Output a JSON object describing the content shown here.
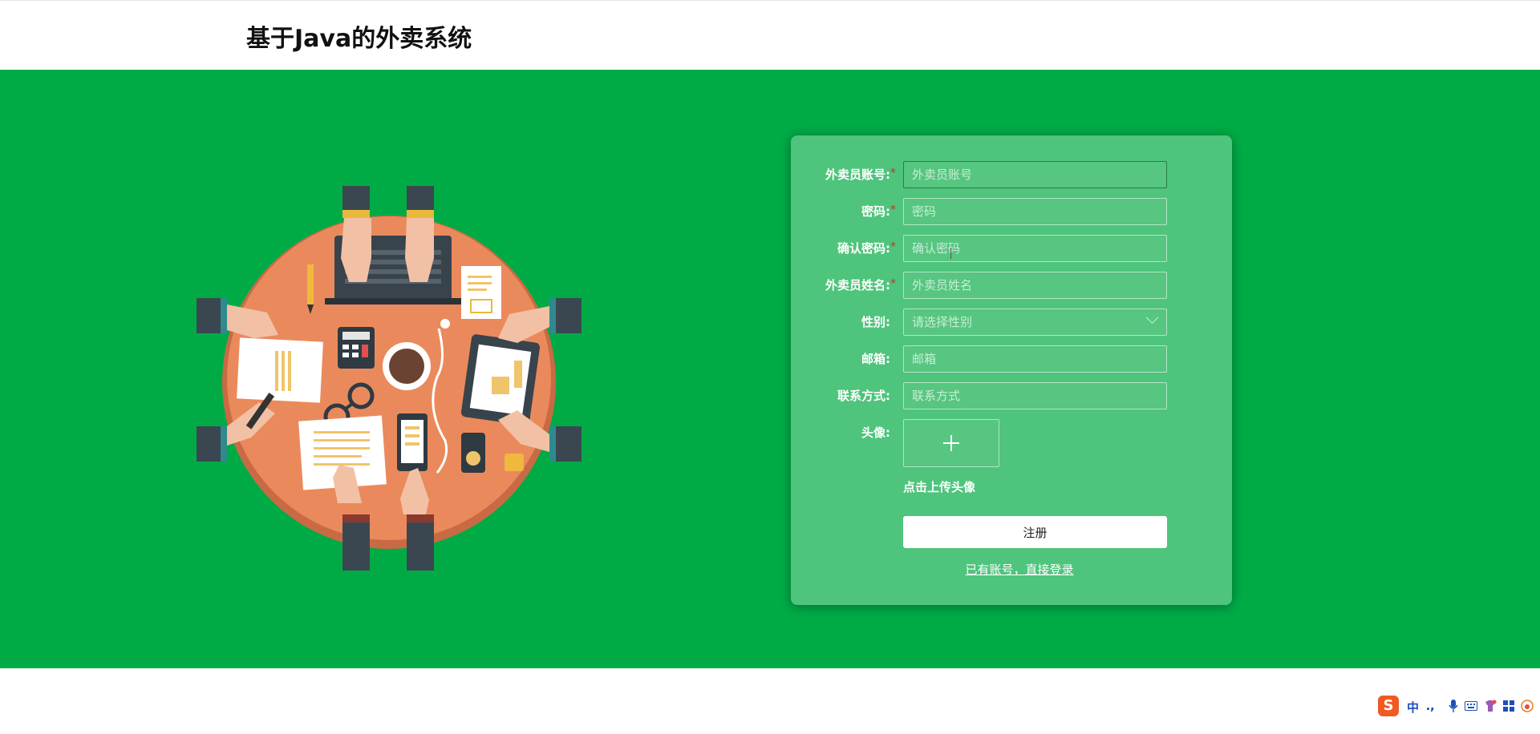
{
  "header": {
    "title": "基于Java的外卖系统"
  },
  "form": {
    "fields": [
      {
        "label": "外卖员账号:",
        "required": true,
        "placeholder": "外卖员账号"
      },
      {
        "label": "密码:",
        "required": true,
        "placeholder": "密码"
      },
      {
        "label": "确认密码:",
        "required": true,
        "placeholder": "确认密码"
      },
      {
        "label": "外卖员姓名:",
        "required": true,
        "placeholder": "外卖员姓名"
      },
      {
        "label": "性别:",
        "required": false,
        "placeholder": "请选择性别"
      },
      {
        "label": "邮箱:",
        "required": false,
        "placeholder": "邮箱"
      },
      {
        "label": "联系方式:",
        "required": false,
        "placeholder": "联系方式"
      }
    ],
    "required_mark": "*",
    "avatar_label": "头像:",
    "avatar_hint": "点击上传头像",
    "submit_label": "注册",
    "login_link": "已有账号，直接登录"
  },
  "ime": {
    "mode_label": "中",
    "logo": "S"
  },
  "colors": {
    "hero_bg": "#00ab46",
    "card_bg": "#4fc47c",
    "required": "#e0242c"
  }
}
